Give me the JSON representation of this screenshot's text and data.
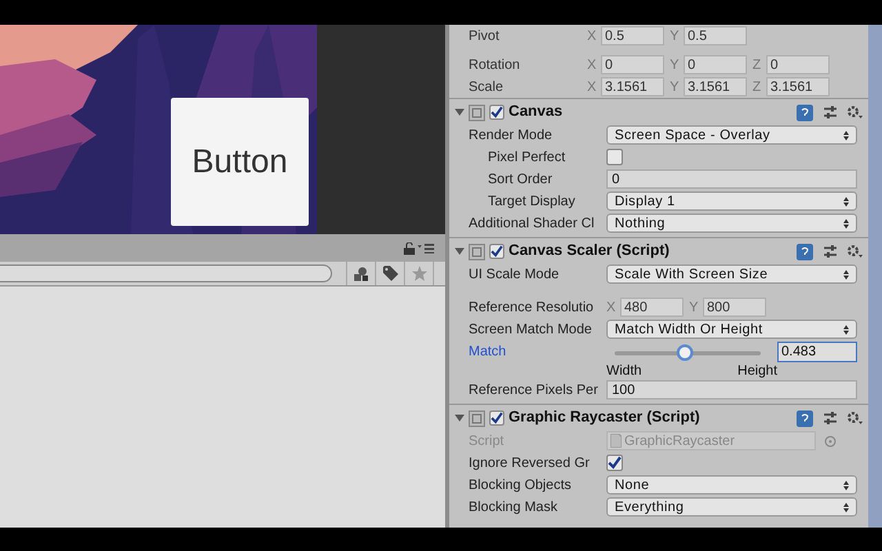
{
  "scene": {
    "button_label": "Button"
  },
  "inspector": {
    "transform": [
      {
        "label": "Pivot",
        "axes": [
          {
            "axis": "X",
            "value": "0.5"
          },
          {
            "axis": "Y",
            "value": "0.5"
          }
        ]
      },
      {
        "label": "Rotation",
        "axes": [
          {
            "axis": "X",
            "value": "0"
          },
          {
            "axis": "Y",
            "value": "0"
          },
          {
            "axis": "Z",
            "value": "0"
          }
        ]
      },
      {
        "label": "Scale",
        "axes": [
          {
            "axis": "X",
            "value": "3.1561"
          },
          {
            "axis": "Y",
            "value": "3.1561"
          },
          {
            "axis": "Z",
            "value": "3.1561"
          }
        ]
      }
    ],
    "components": [
      {
        "title": "Canvas",
        "expanded": true,
        "enabled": true,
        "properties": [
          {
            "kind": "dropdown",
            "label": "Render Mode",
            "value": "Screen Space - Overlay",
            "children": [
              {
                "kind": "checkbox",
                "label": "Pixel Perfect",
                "checked": false
              },
              {
                "kind": "field",
                "label": "Sort Order",
                "value": "0"
              },
              {
                "kind": "dropdown",
                "label": "Target Display",
                "value": "Display 1"
              }
            ]
          },
          {
            "kind": "dropdown",
            "label": "Additional Shader Cl",
            "value": "Nothing"
          }
        ]
      },
      {
        "title": "Canvas Scaler (Script)",
        "expanded": true,
        "enabled": true,
        "properties": [
          {
            "kind": "dropdown",
            "label": "UI Scale Mode",
            "value": "Scale With Screen Size"
          },
          {
            "kind": "vector",
            "label": "Reference Resolutio",
            "axes": [
              {
                "axis": "X",
                "value": "480"
              },
              {
                "axis": "Y",
                "value": "800"
              }
            ]
          },
          {
            "kind": "dropdown",
            "label": "Screen Match Mode",
            "value": "Match Width Or Height"
          },
          {
            "kind": "slider",
            "label": "Match",
            "highlighted": true,
            "level": 0.483,
            "value": "0.483",
            "min_label": "Width",
            "max_label": "Height"
          },
          {
            "kind": "field",
            "label": "Reference Pixels Per",
            "value": "100"
          }
        ]
      },
      {
        "title": "Graphic Raycaster (Script)",
        "expanded": true,
        "enabled": true,
        "properties": [
          {
            "kind": "object",
            "label": "Script",
            "value": "GraphicRaycaster",
            "disabled": true
          },
          {
            "kind": "checkbox",
            "label": "Ignore Reversed Gr",
            "checked": true
          },
          {
            "kind": "dropdown",
            "label": "Blocking Objects",
            "value": "None"
          },
          {
            "kind": "dropdown",
            "label": "Blocking Mask",
            "value": "Everything"
          }
        ]
      }
    ]
  }
}
